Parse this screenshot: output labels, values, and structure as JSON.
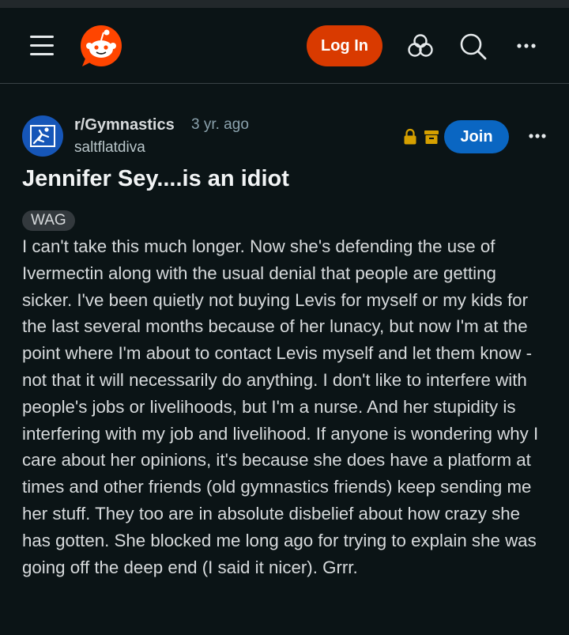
{
  "header": {
    "menu_icon": "hamburger-menu-icon",
    "logo_icon": "reddit-snoo-logo",
    "login_label": "Log In",
    "advertise_icon": "advertise-icon",
    "search_icon": "search-icon",
    "more_icon": "more-horizontal-icon",
    "accent_color": "#d93a00"
  },
  "post": {
    "subreddit": "r/Gymnastics",
    "age": "3 yr. ago",
    "author": "saltflatdiva",
    "join_label": "Join",
    "join_color": "#0a66c2",
    "lock_icon": "lock-icon",
    "archive_icon": "archive-icon",
    "status_color": "#d6a000",
    "more_icon": "more-horizontal-icon",
    "title": "Jennifer Sey....is an idiot",
    "flair": "WAG",
    "body": "I can't take this much longer. Now she's defending the use of Ivermectin along with the usual denial that people are getting sicker. I've been quietly not buying Levis for myself or my kids for the last several months because of her lunacy, but now I'm at the point where I'm about to contact Levis myself and let them know - not that it will necessarily do anything. I don't like to interfere with people's jobs or livelihoods, but I'm a nurse. And her stupidity is interfering with my job and livelihood. If anyone is wondering why I care about her opinions, it's because she does have a platform at times and other friends (old gymnastics friends) keep sending me her stuff. They too are in absolute disbelief about how crazy she has gotten. She blocked me long ago for trying to explain she was going off the deep end (I said it nicer). Grrr."
  }
}
